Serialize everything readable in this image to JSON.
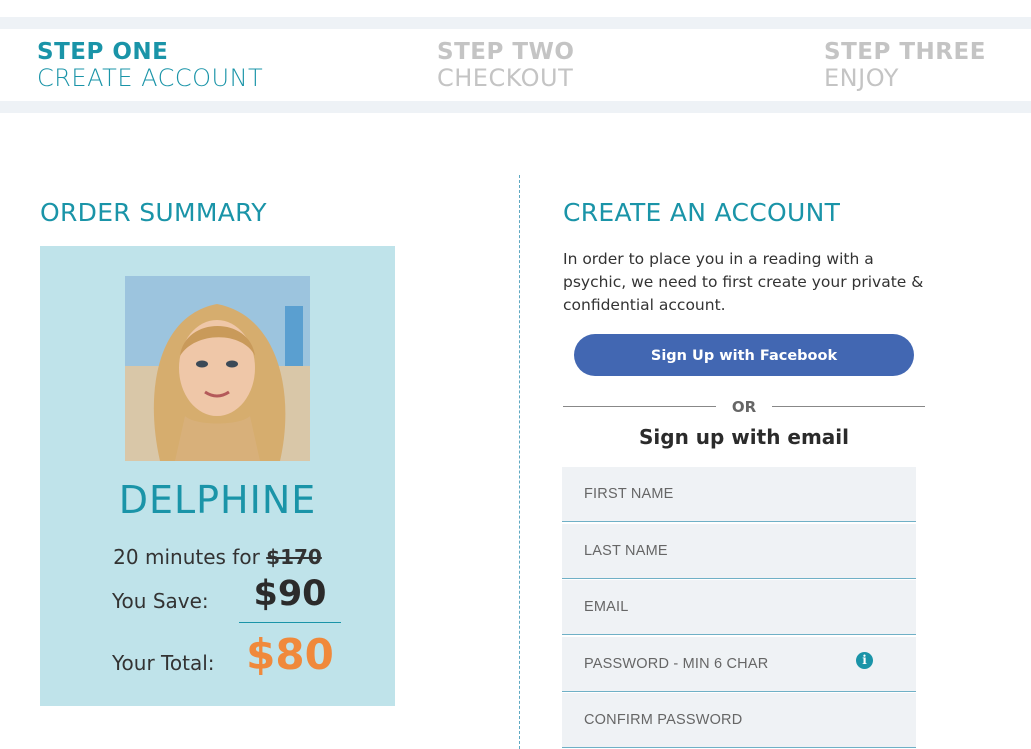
{
  "steps": [
    {
      "number": "STEP ONE",
      "name": "CREATE ACCOUNT",
      "state": "active"
    },
    {
      "number": "STEP TWO",
      "name": "CHECKOUT",
      "state": "inactive"
    },
    {
      "number": "STEP THREE",
      "name": "ENJOY",
      "state": "inactive"
    }
  ],
  "order_summary": {
    "title": "ORDER SUMMARY",
    "psychic_name": "DELPHINE",
    "duration_text": "20 minutes for",
    "original_price": "$170",
    "save_label": "You Save:",
    "save_value": "$90",
    "total_label": "Your Total:",
    "total_value": "$80"
  },
  "account": {
    "title": "CREATE AN ACCOUNT",
    "intro": "In order to place you in a reading with a psychic, we need to first create your private & confidential account.",
    "facebook_button": "Sign Up with Facebook",
    "or_text": "OR",
    "email_heading": "Sign up with email",
    "fields": {
      "first_name": "FIRST NAME",
      "last_name": "LAST NAME",
      "email": "EMAIL",
      "password": "PASSWORD - MIN 6 CHAR",
      "confirm_password": "CONFIRM PASSWORD"
    }
  },
  "colors": {
    "accent": "#1a94a8",
    "inactive_step": "#c4c4c4",
    "summary_bg": "#bfe3ea",
    "total_price": "#f0893b",
    "facebook": "#4267b2"
  },
  "icons": {
    "password_info": "info-icon"
  }
}
